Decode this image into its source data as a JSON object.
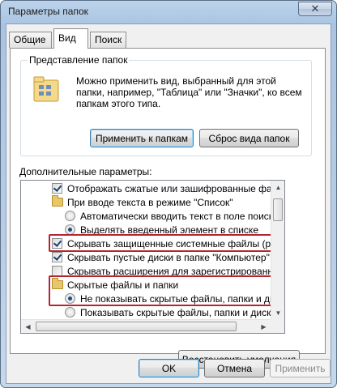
{
  "window": {
    "title": "Параметры папок",
    "close_label": "✕"
  },
  "tabs": [
    {
      "label": "Общие"
    },
    {
      "label": "Вид"
    },
    {
      "label": "Поиск"
    }
  ],
  "folder_view": {
    "legend": "Представление папок",
    "description": "Можно применить вид, выбранный для этой папки, например, \"Таблица\" или \"Значки\", ко всем папкам этого типа.",
    "apply_label": "Применить к папкам",
    "reset_label": "Сброс вида папок"
  },
  "advanced": {
    "label": "Дополнительные параметры:",
    "items": [
      {
        "type": "checkbox",
        "checked": true,
        "label": "Отображать сжатые или зашифрованные файлы NTFS"
      },
      {
        "type": "folder",
        "label": "При вводе текста в режиме \"Список\""
      },
      {
        "type": "radio",
        "checked": false,
        "label": "Автоматически вводить текст в поле поиска"
      },
      {
        "type": "radio",
        "checked": true,
        "label": "Выделять введенный элемент в списке"
      },
      {
        "type": "checkbox",
        "checked": true,
        "label": "Скрывать защищенные системные файлы (рекомендуется)"
      },
      {
        "type": "checkbox",
        "checked": true,
        "label": "Скрывать пустые диски в папке \"Компьютер\""
      },
      {
        "type": "checkbox",
        "checked": false,
        "label": "Скрывать расширения для зарегистрированных типов файлов"
      },
      {
        "type": "folder",
        "label": "Скрытые файлы и папки"
      },
      {
        "type": "radio",
        "checked": true,
        "label": "Не показывать скрытые файлы, папки и диски"
      },
      {
        "type": "radio",
        "checked": false,
        "label": "Показывать скрытые файлы, папки и диски"
      }
    ]
  },
  "buttons": {
    "restore_defaults": "Восстановить умолчания",
    "ok": "OK",
    "cancel": "Отмена",
    "apply": "Применить"
  },
  "colors": {
    "highlight": "#b3262e",
    "selected_radio": "#1f4b8a"
  }
}
